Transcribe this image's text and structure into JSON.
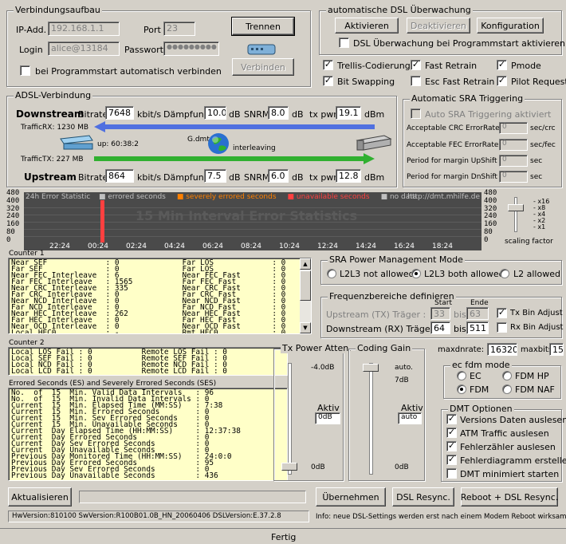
{
  "conn": {
    "title": "Verbindungsaufbau",
    "ip_label": "IP-Add.",
    "ip_value": "192.168.1.1",
    "port_label": "Port",
    "port_value": "23",
    "login_label": "Login",
    "login_value": "alice@13184",
    "pw_label": "Passwort",
    "pw_value": "●●●●●●●●●",
    "trennen": "Trennen",
    "verbinden": "Verbinden",
    "autoconnect": "bei Programmstart automatisch verbinden"
  },
  "watch": {
    "title": "automatische DSL Überwachung",
    "aktivieren": "Aktivieren",
    "deaktivieren": "Deaktivieren",
    "konfiguration": "Konfiguration",
    "start_label": "DSL Überwachung bei Programmstart aktivieren"
  },
  "opts": {
    "trellis": "Trellis-Codierung",
    "fast_retrain": "Fast Retrain",
    "pmode": "Pmode",
    "bitswap": "Bit Swapping",
    "esc_fast": "Esc Fast Retrain",
    "pilot": "Pilot Request"
  },
  "adsl": {
    "title": "ADSL-Verbindung",
    "ds_label": "Downstream",
    "bitrate_label": "Bitrate",
    "ds_bitrate": "7648",
    "kbits": "kbit/s",
    "daempfung_label": "Dämpfung",
    "ds_daempfung": "10.0",
    "db": "dB",
    "snrm_label": "SNRM",
    "ds_snrm": "8.0",
    "txpwr_label": "tx pwr",
    "ds_txpwr": "19.1",
    "dbm": "dBm",
    "traffic_rx": "TrafficRX: 1230 MB",
    "uptime": "up: 60:38:2",
    "mode": "G.dmt",
    "interleaving": "interleaving",
    "traffic_tx": "TrafficTX: 227 MB",
    "us_label": "Upstream",
    "us_bitrate": "864",
    "us_daempfung": "7.5",
    "us_snrm": "6.0",
    "us_txpwr": "12.8"
  },
  "sra": {
    "title": "Automatic SRA Triggering",
    "auto_label": "Auto SRA Triggering aktiviert",
    "crc_label": "Acceptable CRC ErrorRate",
    "crc_value": "0",
    "crc_unit": "sec/crc",
    "fec_label": "Acceptable FEC ErrorRate",
    "fec_value": "0",
    "fec_unit": "sec/fec",
    "upshift_label": "Period for margin UpShift",
    "upshift_value": "0",
    "upshift_unit": "sec",
    "dnshift_label": "Period for margin DnShift",
    "dnshift_value": "0",
    "dnshift_unit": "sec"
  },
  "chart_data": {
    "type": "bar",
    "title": "24h Error Statistic",
    "watermark": "15 Min Interval Error Statistics",
    "url": "http://dmt.mhilfe.de",
    "legend": [
      {
        "name": "errored seconds",
        "color": "#c0c0c0"
      },
      {
        "name": "severely errored seconds",
        "color": "#ff8000"
      },
      {
        "name": "unavailable seconds",
        "color": "#ff4040"
      },
      {
        "name": "no data",
        "color": "#c0c0c0"
      }
    ],
    "y_ticks": [
      "480",
      "400",
      "320",
      "240",
      "160",
      "80",
      "0"
    ],
    "x_ticks": [
      "22:24",
      "00:24",
      "02:24",
      "04:24",
      "06:24",
      "08:24",
      "10:24",
      "12:24",
      "14:24",
      "16:24",
      "18:24"
    ],
    "ylim": [
      0,
      480
    ],
    "bars": [
      {
        "x": "01:04",
        "series": "unavailable seconds",
        "value": 480
      }
    ]
  },
  "scaling": {
    "marks": [
      "x16",
      "x8",
      "x4",
      "x2",
      "x1"
    ],
    "label": "scaling factor"
  },
  "counter1": {
    "title": "Counter 1",
    "lines": [
      "Near SEF             : 0              Far LOS             : 0",
      "Far SEF              : 0              Far LOS             : 0",
      "Near FEC Interleave  : 6              Near FEC Fast       : 0",
      "Far FEC Interleave   : 1565           Far FEC Fast        : 0",
      "Near CRC Interleave  : 335            Near CRC Fast       : 0",
      "Far CRC Interleave   : 0              Far CRC Fast        : 0",
      "Near NCD Interleave  : 0              Near NCD Fast       : 0",
      "Far NCD Interleave   : 0              Far NCD Fast        : 0",
      "Near HEC Interleave  : 262            Near HEC Fast       : 0",
      "Far HEC Interleave   : 0              Far HEC Fast        : 0",
      "Near OCD Interleave  : 0              Near OCD Fast       : 0",
      "Local HEC0           : -              Rmt HEC0            : 0"
    ]
  },
  "counter2": {
    "title": "Counter 2",
    "lines": [
      "Local LOS Fail : 0           Remote LOS Fail : 0",
      "Local SEF Fail : 0           Remote SEF Fail : 0",
      "Local NCD Fail : 0           Remote NCD Fail : 0",
      "Local LCD Fail : 0           Remote LCD Fail : 0"
    ]
  },
  "ses": {
    "title": "Errored Seconds (ES) and Severely Errored Seconds (SES)",
    "lines": [
      "No.  of  15  Min. Valid Data Intervals   : 96",
      "No.  of  15  Min. Invalid Data Intervals : 0",
      "Current  15  Min. Elapsed Time (MM:SS)   : 7:38",
      "Current  15  Min. Errored Seconds        : 0",
      "Current  15  Min. Sev Errored Seconds    : 0",
      "Current  15  Min. Unavailable Seconds    : 0",
      "Current  Day Elapsed Time (HH:MM:SS)     : 12:37:38",
      "Current  Day Errored Seconds             : 0",
      "Current  Day Sev Errored Seconds         : 0",
      "Current  Day Unavailable Seconds         : 0",
      "Previous Day Monitored Time (HH:MM:SS)   : 24:0:0",
      "Previous Day Errored Seconds             : 95",
      "Previous Day Sev Errored Seconds         : 0",
      "Previous Day Unavailable Seconds         : 436"
    ]
  },
  "srapm": {
    "title": "SRA Power Management Mode",
    "l2l3_not": "L2L3 not allowed",
    "l2l3_both": "L2L3 both allowed",
    "l2": "L2 allowed"
  },
  "freq": {
    "title": "Frequenzbereiche definieren",
    "start": "Start",
    "ende": "Ende",
    "us_label": "Upstream (TX) Träger :",
    "us_start": "33",
    "bis": "bis",
    "us_end": "63",
    "tx_adjust": "Tx Bin Adjust",
    "ds_label": "Downstream (RX) Träger :",
    "ds_start": "64",
    "ds_end": "511",
    "rx_adjust": "Rx Bin Adjust"
  },
  "txatt": {
    "title": "Tx Power Atten.",
    "top": "-4.0dB",
    "bottom": "0dB",
    "aktiv_label": "Aktiv",
    "aktiv_value": "0dB"
  },
  "coding": {
    "title": "Coding Gain",
    "auto": "auto.",
    "top": "7dB",
    "bottom": "0dB",
    "aktiv_label": "Aktiv",
    "aktiv_value": "auto"
  },
  "maxdn": {
    "label": "maxdnrate:",
    "value": "16320",
    "bits_label": "maxbits:",
    "bits_value": "15"
  },
  "fdm": {
    "title": "ec fdm mode",
    "ec": "EC",
    "fdm_hp": "FDM HP",
    "fdm": "FDM",
    "fdm_naf": "FDM NAF"
  },
  "dmt": {
    "title": "DMT Optionen",
    "o1": "Versions Daten auslesen",
    "o2": "ATM Traffic auslesen",
    "o3": "Fehlerzähler auslesen",
    "o4": "Fehlerdiagramm erstellen",
    "o5": "DMT minimiert starten"
  },
  "bottom": {
    "aktualisieren": "Aktualisieren",
    "uebernehmen": "Übernehmen",
    "dsl_resync": "DSL Resync.",
    "reboot_resync": "Reboot + DSL Resync.",
    "version": "HwVersion:810100  SwVersion:R100B01.0B_HN_20060406  DSLVersion:E.37.2.8",
    "info": "Info: neue DSL-Settings werden erst nach einem Modem Reboot wirksam",
    "status": "Fertig"
  }
}
